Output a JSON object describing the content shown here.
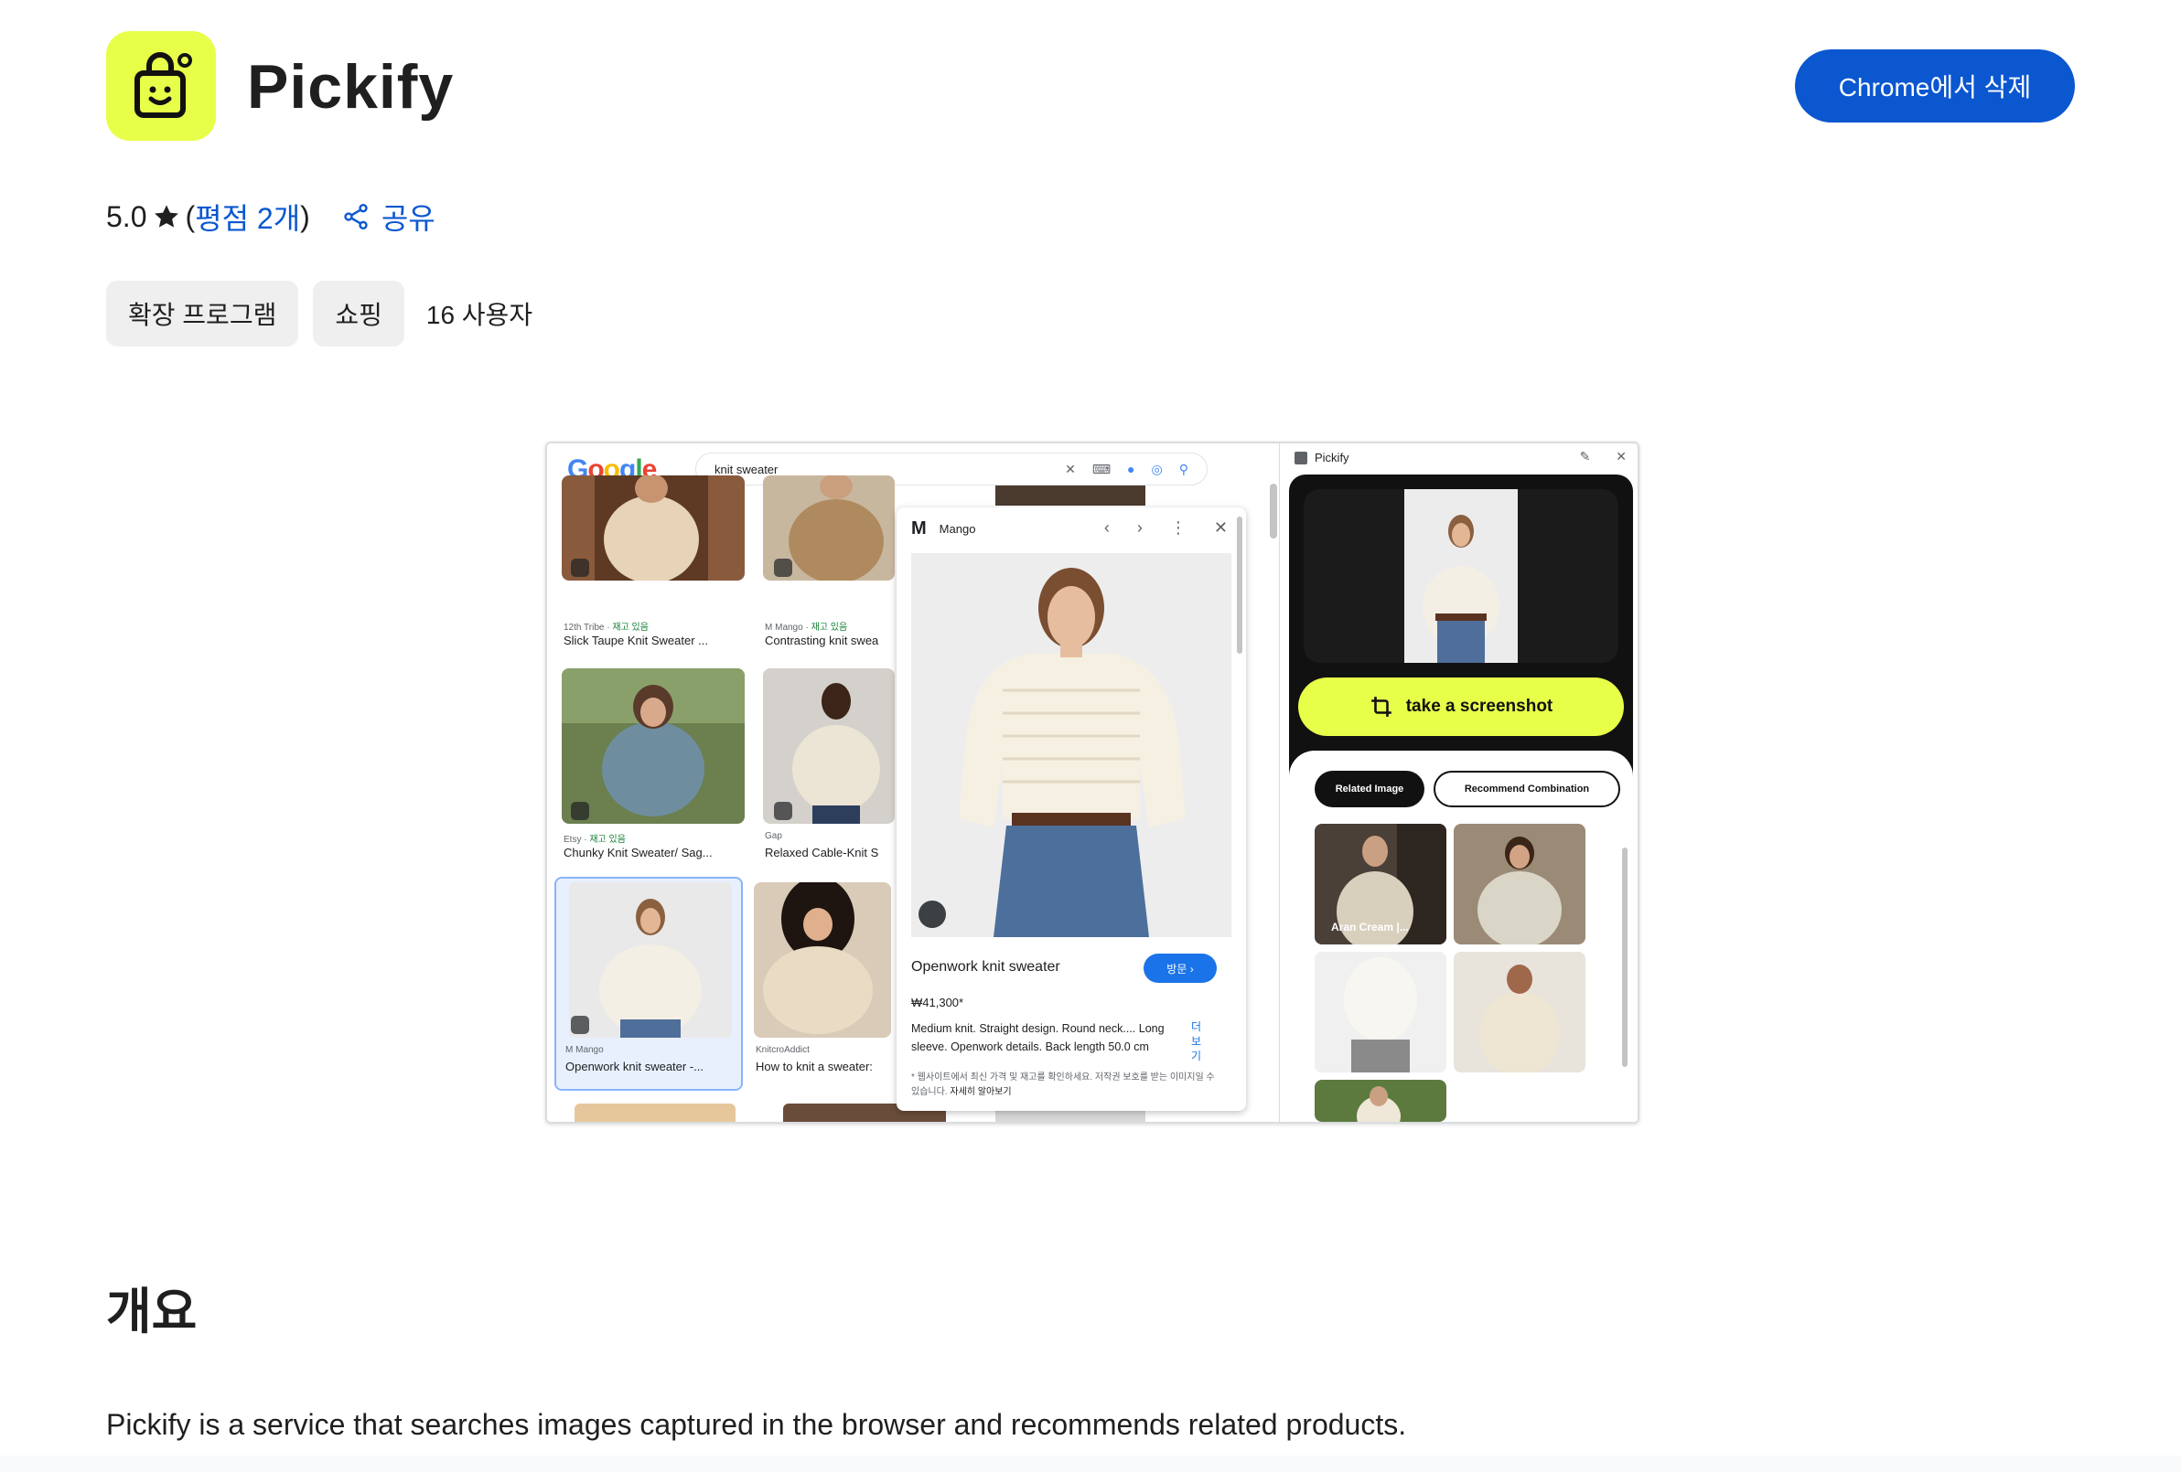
{
  "header": {
    "app_name": "Pickify",
    "remove_button": "Chrome에서 삭제",
    "brand_color": "#e8ff4a",
    "primary_color": "#0b57d0"
  },
  "rating": {
    "value": "5.0",
    "open_paren": "(",
    "count_label": "평점 2개",
    "close_paren": ")",
    "share_label": "공유"
  },
  "chips": {
    "category": "확장 프로그램",
    "subcategory": "쇼핑",
    "users": "16 사용자"
  },
  "screenshot": {
    "google": {
      "logo": [
        "G",
        "o",
        "o",
        "g",
        "l",
        "e"
      ],
      "query": "knit sweater",
      "results": [
        {
          "meta_source": "12th Tribe · ",
          "meta_stock": "재고 있음",
          "title": "Slick Taupe Knit Sweater ..."
        },
        {
          "meta_source": "M Mango · ",
          "meta_stock": "재고 있음",
          "title": "Contrasting knit swea"
        },
        {
          "meta_source": "Etsy · ",
          "meta_stock": "재고 있음",
          "title": "Chunky Knit Sweater/ Sag..."
        },
        {
          "meta_source": "Gap",
          "meta_stock": "",
          "title": "Relaxed Cable-Knit S"
        },
        {
          "meta_source": "M Mango",
          "meta_stock": "",
          "title": "Openwork knit sweater -..."
        },
        {
          "meta_source": "KnitcroAddict",
          "meta_stock": "",
          "title": "How to knit a sweater:"
        }
      ],
      "detail": {
        "store": "Mango",
        "store_letter": "M",
        "title": "Openwork knit sweater",
        "visit": "방문 ›",
        "price": "₩41,300*",
        "description": "Medium knit. Straight design. Round neck.... Long sleeve. Openwork details. Back length 50.0 cm",
        "more": "더보기",
        "note": "* 웹사이트에서 최신 가격 및 재고를 확인하세요. 저작권 보호를 받는 이미지일 수 있습니다.",
        "note_link": "자세히 알아보기"
      }
    },
    "pickify": {
      "panel_title": "Pickify",
      "screenshot_button": "take a screenshot",
      "tab_related": "Related Image",
      "tab_recommend": "Recommend Combination",
      "first_item_label": "Aran Cream |..."
    }
  },
  "overview": {
    "heading": "개요",
    "description": "Pickify is a service that searches images captured in the browser and recommends related products."
  }
}
